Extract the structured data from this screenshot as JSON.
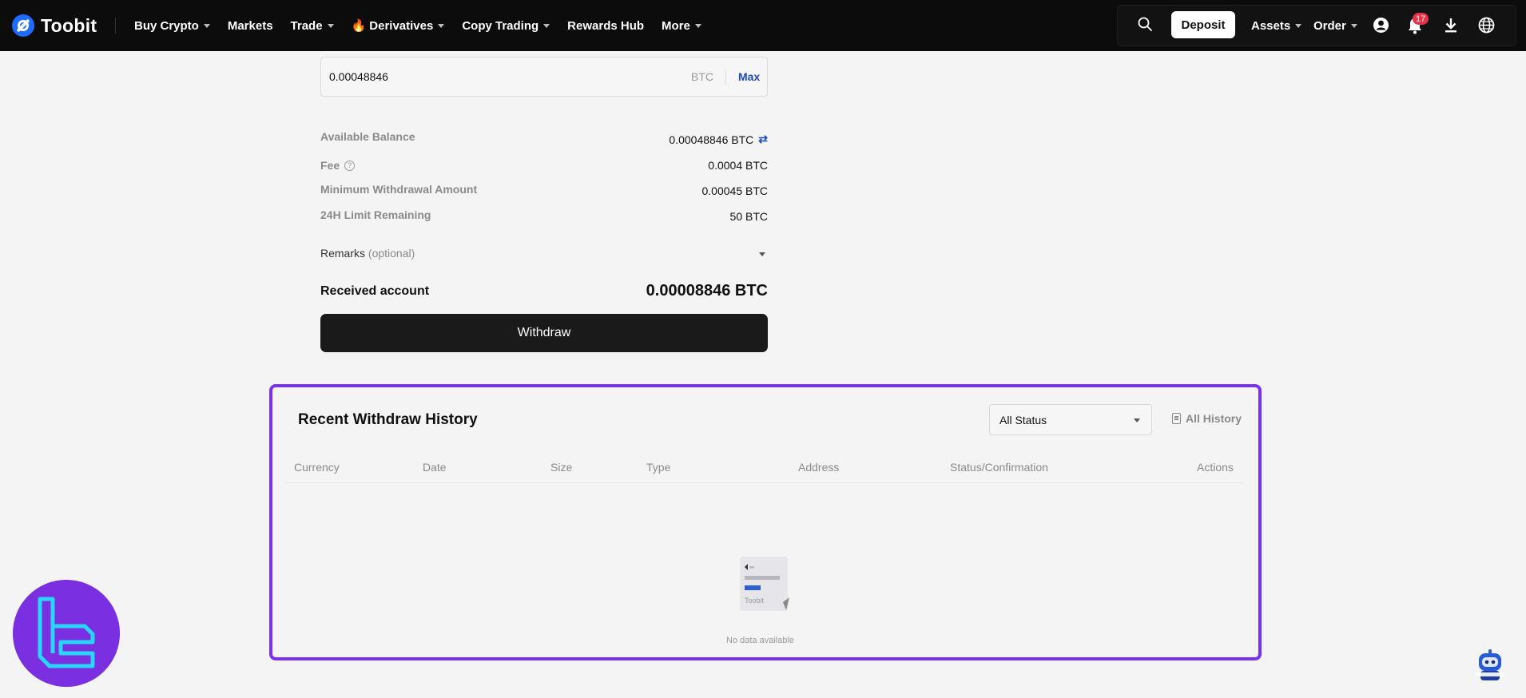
{
  "nav": {
    "brand": "Toobit",
    "menu": [
      {
        "label": "Buy Crypto",
        "dropdown": true
      },
      {
        "label": "Markets",
        "dropdown": false
      },
      {
        "label": "Trade",
        "dropdown": true
      },
      {
        "label": "Derivatives",
        "dropdown": true,
        "icon": "fire-icon"
      },
      {
        "label": "Copy Trading",
        "dropdown": true
      },
      {
        "label": "Rewards Hub",
        "dropdown": false
      },
      {
        "label": "More",
        "dropdown": true
      }
    ],
    "deposit": "Deposit",
    "assets": "Assets",
    "order": "Order",
    "notification_count": "17"
  },
  "form": {
    "amount_value": "0.00048846",
    "amount_unit": "BTC",
    "max_label": "Max",
    "rows": [
      {
        "label": "Available Balance",
        "value": "0.00048846 BTC"
      },
      {
        "label": "Fee",
        "value": "0.0004 BTC"
      },
      {
        "label": "Minimum Withdrawal Amount",
        "value": "0.00045 BTC"
      },
      {
        "label": "24H Limit Remaining",
        "value": "50 BTC"
      }
    ],
    "remarks_label": "Remarks",
    "remarks_optional": "(optional)",
    "received_label": "Received account",
    "received_value": "0.00008846 BTC",
    "withdraw_label": "Withdraw"
  },
  "history": {
    "title": "Recent Withdraw History",
    "status_filter": "All Status",
    "all_history": "All History",
    "columns": [
      "Currency",
      "Date",
      "Size",
      "Type",
      "Address",
      "Status/Confirmation",
      "Actions"
    ],
    "empty_brand": "Toobit",
    "empty_text": "No data available"
  },
  "colors": {
    "accent": "#1d4ab8",
    "highlight": "#7b2ff2",
    "nav_bg": "#0c0c0d",
    "badge": "#e5344a"
  }
}
